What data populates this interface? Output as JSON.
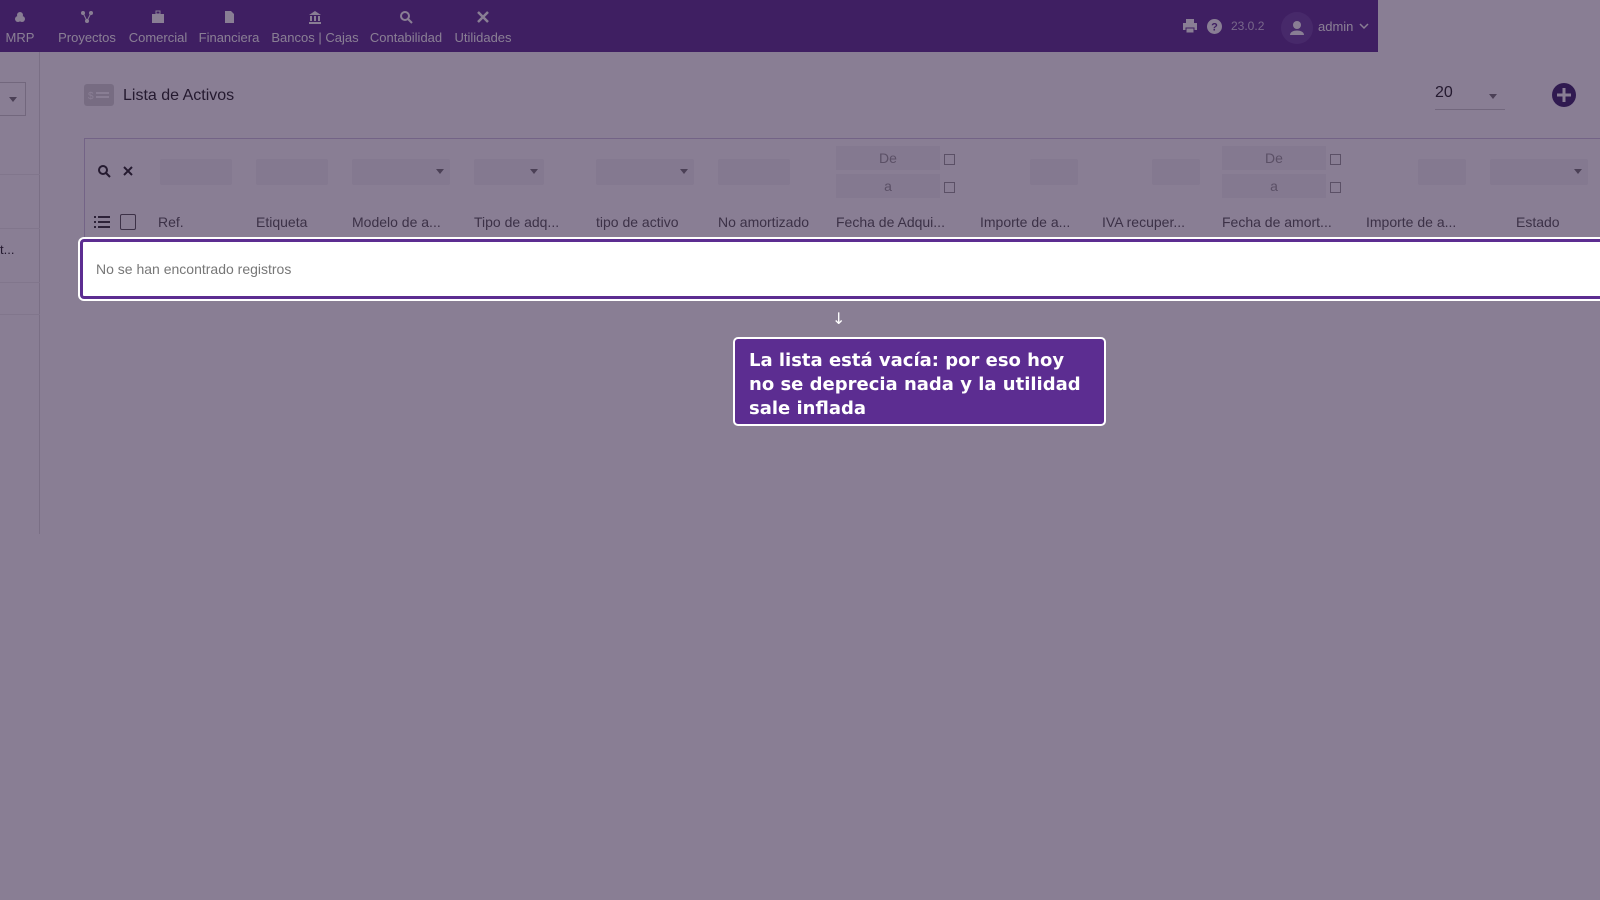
{
  "menu": [
    {
      "label": "MRP",
      "icon": "cubes-icon"
    },
    {
      "label": "Proyectos",
      "icon": "project-icon"
    },
    {
      "label": "Comercial",
      "icon": "briefcase-icon"
    },
    {
      "label": "Financiera",
      "icon": "invoice-icon"
    },
    {
      "label": "Bancos | Cajas",
      "icon": "bank-icon"
    },
    {
      "label": "Contabilidad",
      "icon": "search-icon"
    },
    {
      "label": "Utilidades",
      "icon": "tools-icon"
    }
  ],
  "header": {
    "version": "23.0.2",
    "user": "admin"
  },
  "sidebar": {
    "partial_text": "t..."
  },
  "page": {
    "title": "Lista de Activos",
    "limit": "20"
  },
  "filters": {
    "date_from": "De",
    "date_to": "a"
  },
  "columns": [
    "Ref.",
    "Etiqueta",
    "Modelo de a...",
    "Tipo de adq...",
    "tipo de activo",
    "No amortizado",
    "Fecha de Adqui...",
    "Importe de a...",
    "IVA recuper...",
    "Fecha de amort...",
    "Importe de a...",
    "Estado"
  ],
  "table": {
    "empty_message": "No se han encontrado registros"
  },
  "callout": {
    "arrow": "↓",
    "text": "La lista está vacía: por eso hoy no se deprecia nada y la utilidad sale inflada"
  },
  "colors": {
    "brand": "#5c2d91",
    "overlay": "rgba(40,20,60,0.55)"
  }
}
